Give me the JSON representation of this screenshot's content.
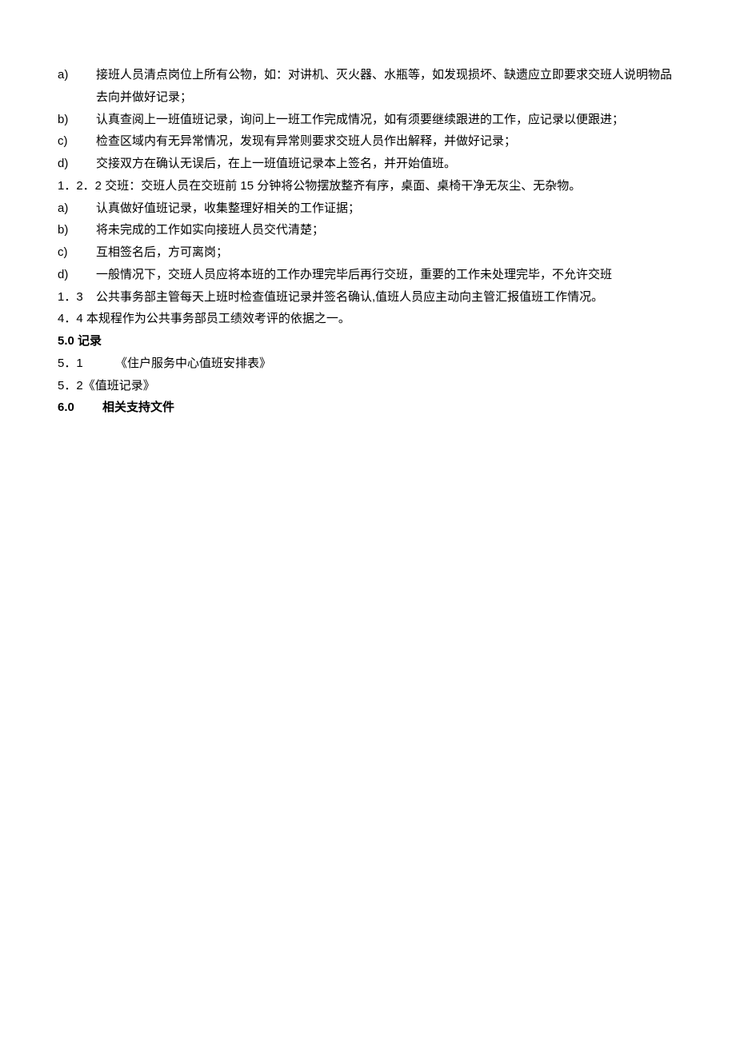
{
  "items": [
    {
      "marker": "a)",
      "type": "alpha",
      "text": "接班人员清点岗位上所有公物，如：对讲机、灭火器、水瓶等，如发现损坏、缺遗应立即要求交班人说明物品去向并做好记录；"
    },
    {
      "marker": "b)",
      "type": "alpha",
      "text": "认真查阅上一班值班记录，询问上一班工作完成情况，如有须要继续跟进的工作，应记录以便跟进；"
    },
    {
      "marker": "c)",
      "type": "alpha",
      "text": "检查区域内有无异常情况，发现有异常则要求交班人员作出解释，并做好记录；"
    },
    {
      "marker": "d)",
      "type": "alpha",
      "text": "交接双方在确认无误后，在上一班值班记录本上签名，并开始值班。"
    },
    {
      "marker": "1．2．2",
      "type": "num-inline",
      "text": "交班：交班人员在交班前 15 分钟将公物摆放整齐有序，桌面、桌椅干净无灰尘、无杂物。"
    },
    {
      "marker": "a)",
      "type": "alpha",
      "text": "认真做好值班记录，收集整理好相关的工作证据；"
    },
    {
      "marker": "b)",
      "type": "alpha",
      "text": "将未完成的工作如实向接班人员交代清楚；"
    },
    {
      "marker": "c)",
      "type": "alpha",
      "text": "互相签名后，方可离岗；"
    },
    {
      "marker": "d)",
      "type": "alpha",
      "text": "一般情况下，交班人员应将本班的工作办理完毕后再行交班，重要的工作未处理完毕，不允许交班"
    },
    {
      "marker": "1．3",
      "type": "alpha",
      "text": "公共事务部主管每天上班时检查值班记录并签名确认,值班人员应主动向主管汇报值班工作情况。"
    },
    {
      "marker": "4．4",
      "type": "num-inline-tight",
      "text": "本规程作为公共事务部员工绩效考评的依据之一。"
    },
    {
      "marker": "5.0",
      "type": "bold-line",
      "text": "记录"
    },
    {
      "marker": "5．1",
      "type": "num-5-1",
      "text": "《住户服务中心值班安排表》"
    },
    {
      "marker": "5．2",
      "type": "num-5-2",
      "text": "《值班记录》"
    },
    {
      "marker": "6.0",
      "type": "bold-6",
      "text": "相关支持文件"
    }
  ]
}
